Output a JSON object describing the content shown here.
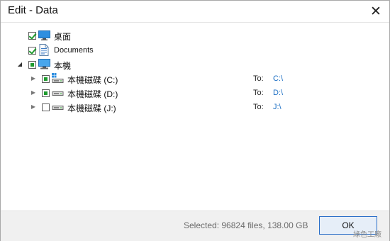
{
  "window": {
    "title": "Edit - Data",
    "close_icon": "close-icon"
  },
  "tree": {
    "items": [
      {
        "label": "桌面",
        "checked": "checked",
        "icon": "desktop-icon"
      },
      {
        "label": "Documents",
        "checked": "checked",
        "icon": "document-icon"
      },
      {
        "label": "本機",
        "checked": "partial",
        "icon": "computer-icon",
        "expanded": true
      }
    ],
    "drives": [
      {
        "label": "本機磁碟 (C:)",
        "checked": "partial",
        "icon": "system-drive-icon",
        "to_label": "To:",
        "destination": "C:\\"
      },
      {
        "label": "本機磁碟 (D:)",
        "checked": "partial",
        "icon": "drive-icon",
        "to_label": "To:",
        "destination": "D:\\"
      },
      {
        "label": "本機磁碟 (J:)",
        "checked": "unchecked",
        "icon": "drive-icon",
        "to_label": "To:",
        "destination": "J:\\"
      }
    ]
  },
  "footer": {
    "status": "Selected: 96824 files, 138.00 GB",
    "ok_label": "OK"
  },
  "watermark": "綠色工廠",
  "colors": {
    "check_green": "#1e9b2e",
    "link_blue": "#1c6fc4",
    "button_border": "#2b6fc8"
  }
}
